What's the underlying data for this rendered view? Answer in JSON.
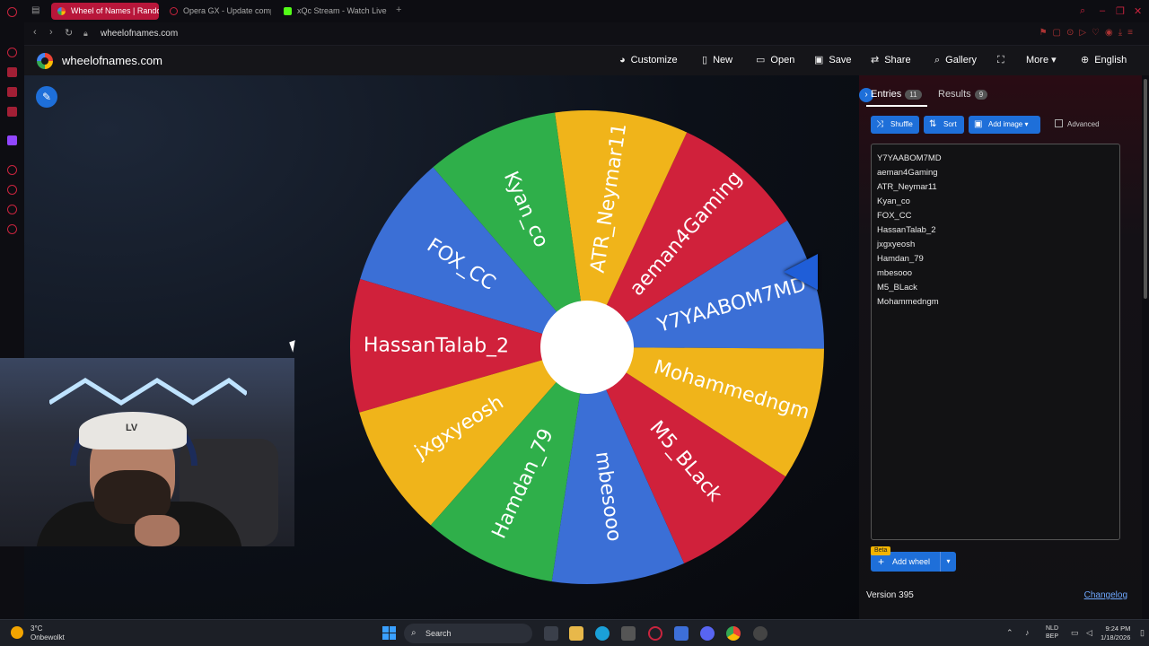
{
  "browser": {
    "tabs": [
      {
        "label": "Wheel of Names | Random",
        "active": true
      },
      {
        "label": "Opera GX - Update comp",
        "active": false
      },
      {
        "label": "xQc Stream - Watch Live",
        "active": false
      }
    ],
    "new_tab": "+",
    "url": "wheelofnames.com"
  },
  "site": {
    "title": "wheelofnames.com",
    "menu": [
      {
        "icon": "palette-icon",
        "glyph": "◕",
        "label": "Customize"
      },
      {
        "icon": "new-file-icon",
        "glyph": "▯",
        "label": "New"
      },
      {
        "icon": "folder-icon",
        "glyph": "▭",
        "label": "Open"
      },
      {
        "icon": "save-icon",
        "glyph": "▣",
        "label": "Save"
      },
      {
        "icon": "share-icon",
        "glyph": "⇄",
        "label": "Share"
      },
      {
        "icon": "search-icon",
        "glyph": "⌕",
        "label": "Gallery"
      },
      {
        "icon": "fullscreen-icon",
        "glyph": "⛶",
        "label": ""
      },
      {
        "icon": "chevron-down-icon",
        "glyph": "▾",
        "label": "More"
      },
      {
        "icon": "globe-icon",
        "glyph": "⊕",
        "label": "English"
      }
    ]
  },
  "wheel": {
    "segments": [
      {
        "name": "Y7YAABOM7MD",
        "color": "#3b6fd6"
      },
      {
        "name": "aeman4Gaming",
        "color": "#d0213b"
      },
      {
        "name": "ATR_Neymar11",
        "color": "#f0b41a"
      },
      {
        "name": "Kyan_co",
        "color": "#2faf4a"
      },
      {
        "name": "FOX_CC",
        "color": "#3b6fd6"
      },
      {
        "name": "HassanTalab_2",
        "color": "#d0213b"
      },
      {
        "name": "jxgxyeosh",
        "color": "#f0b41a"
      },
      {
        "name": "Hamdan_79",
        "color": "#2faf4a"
      },
      {
        "name": "mbesooo",
        "color": "#3b6fd6"
      },
      {
        "name": "M5_BLack",
        "color": "#d0213b"
      },
      {
        "name": "Mohammedngm",
        "color": "#f0b41a"
      }
    ],
    "accent": "#1f5ed8"
  },
  "panel": {
    "entries_tab": "Entries",
    "entries_count": "11",
    "results_tab": "Results",
    "results_count": "9",
    "shuffle": "Shuffle",
    "sort": "Sort",
    "add_image": "Add image",
    "advanced": "Advanced",
    "entries": [
      "Y7YAABOM7MD",
      "aeman4Gaming",
      "ATR_Neymar11",
      "Kyan_co",
      "FOX_CC",
      "HassanTalab_2",
      "jxgxyeosh",
      "Hamdan_79",
      "mbesooo",
      "M5_BLack",
      "Mohammedngm"
    ],
    "beta": "Beta",
    "add_wheel": "Add wheel",
    "version": "Version 395",
    "changelog": "Changelog"
  },
  "taskbar": {
    "temp": "3°C",
    "weather": "Onbewolkt",
    "search": "Search",
    "lang1": "NLD",
    "lang2": "BEP",
    "time": "9:24 PM",
    "date": "1/18/2026"
  }
}
